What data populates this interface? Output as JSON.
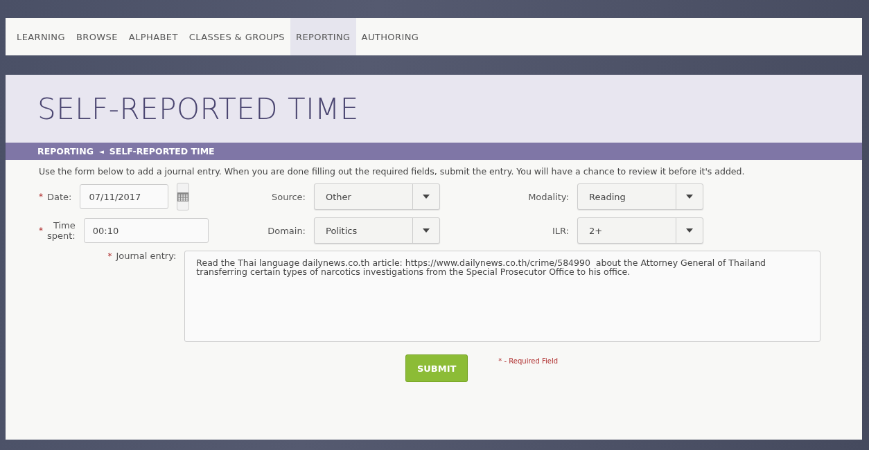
{
  "nav": {
    "items": [
      {
        "label": "LEARNING",
        "selected": false
      },
      {
        "label": "BROWSE",
        "selected": false
      },
      {
        "label": "ALPHABET",
        "selected": false
      },
      {
        "label": "CLASSES & GROUPS",
        "selected": false
      },
      {
        "label": "REPORTING",
        "selected": true
      },
      {
        "label": "AUTHORING",
        "selected": false
      }
    ]
  },
  "page_title": "SELF-REPORTED TIME",
  "breadcrumb": {
    "parent": "REPORTING",
    "separator": "◄",
    "current": "SELF-REPORTED TIME"
  },
  "intro": "Use the form below to add a journal entry. When you are done filling out the required fields, submit the entry. You will have a chance to review it before it's added.",
  "fields": {
    "date": {
      "mark": "*",
      "label": "Date:",
      "value": "07/11/2017"
    },
    "source": {
      "label": "Source:",
      "value": "Other"
    },
    "modality": {
      "label": "Modality:",
      "value": "Reading"
    },
    "time_spent": {
      "mark": "*",
      "label": "Time spent:",
      "value": "00:10"
    },
    "domain": {
      "label": "Domain:",
      "value": "Politics"
    },
    "ilr": {
      "label": "ILR:",
      "value": "2+"
    },
    "journal": {
      "mark": "*",
      "label": "Journal entry:",
      "value": "Read the Thai language dailynews.co.th article: https://www.dailynews.co.th/crime/584990  about the Attorney General of Thailand transferring certain types of narcotics investigations from the Special Prosecutor Office to his office."
    }
  },
  "submit": "SUBMIT",
  "required_note": "* - Required Field"
}
